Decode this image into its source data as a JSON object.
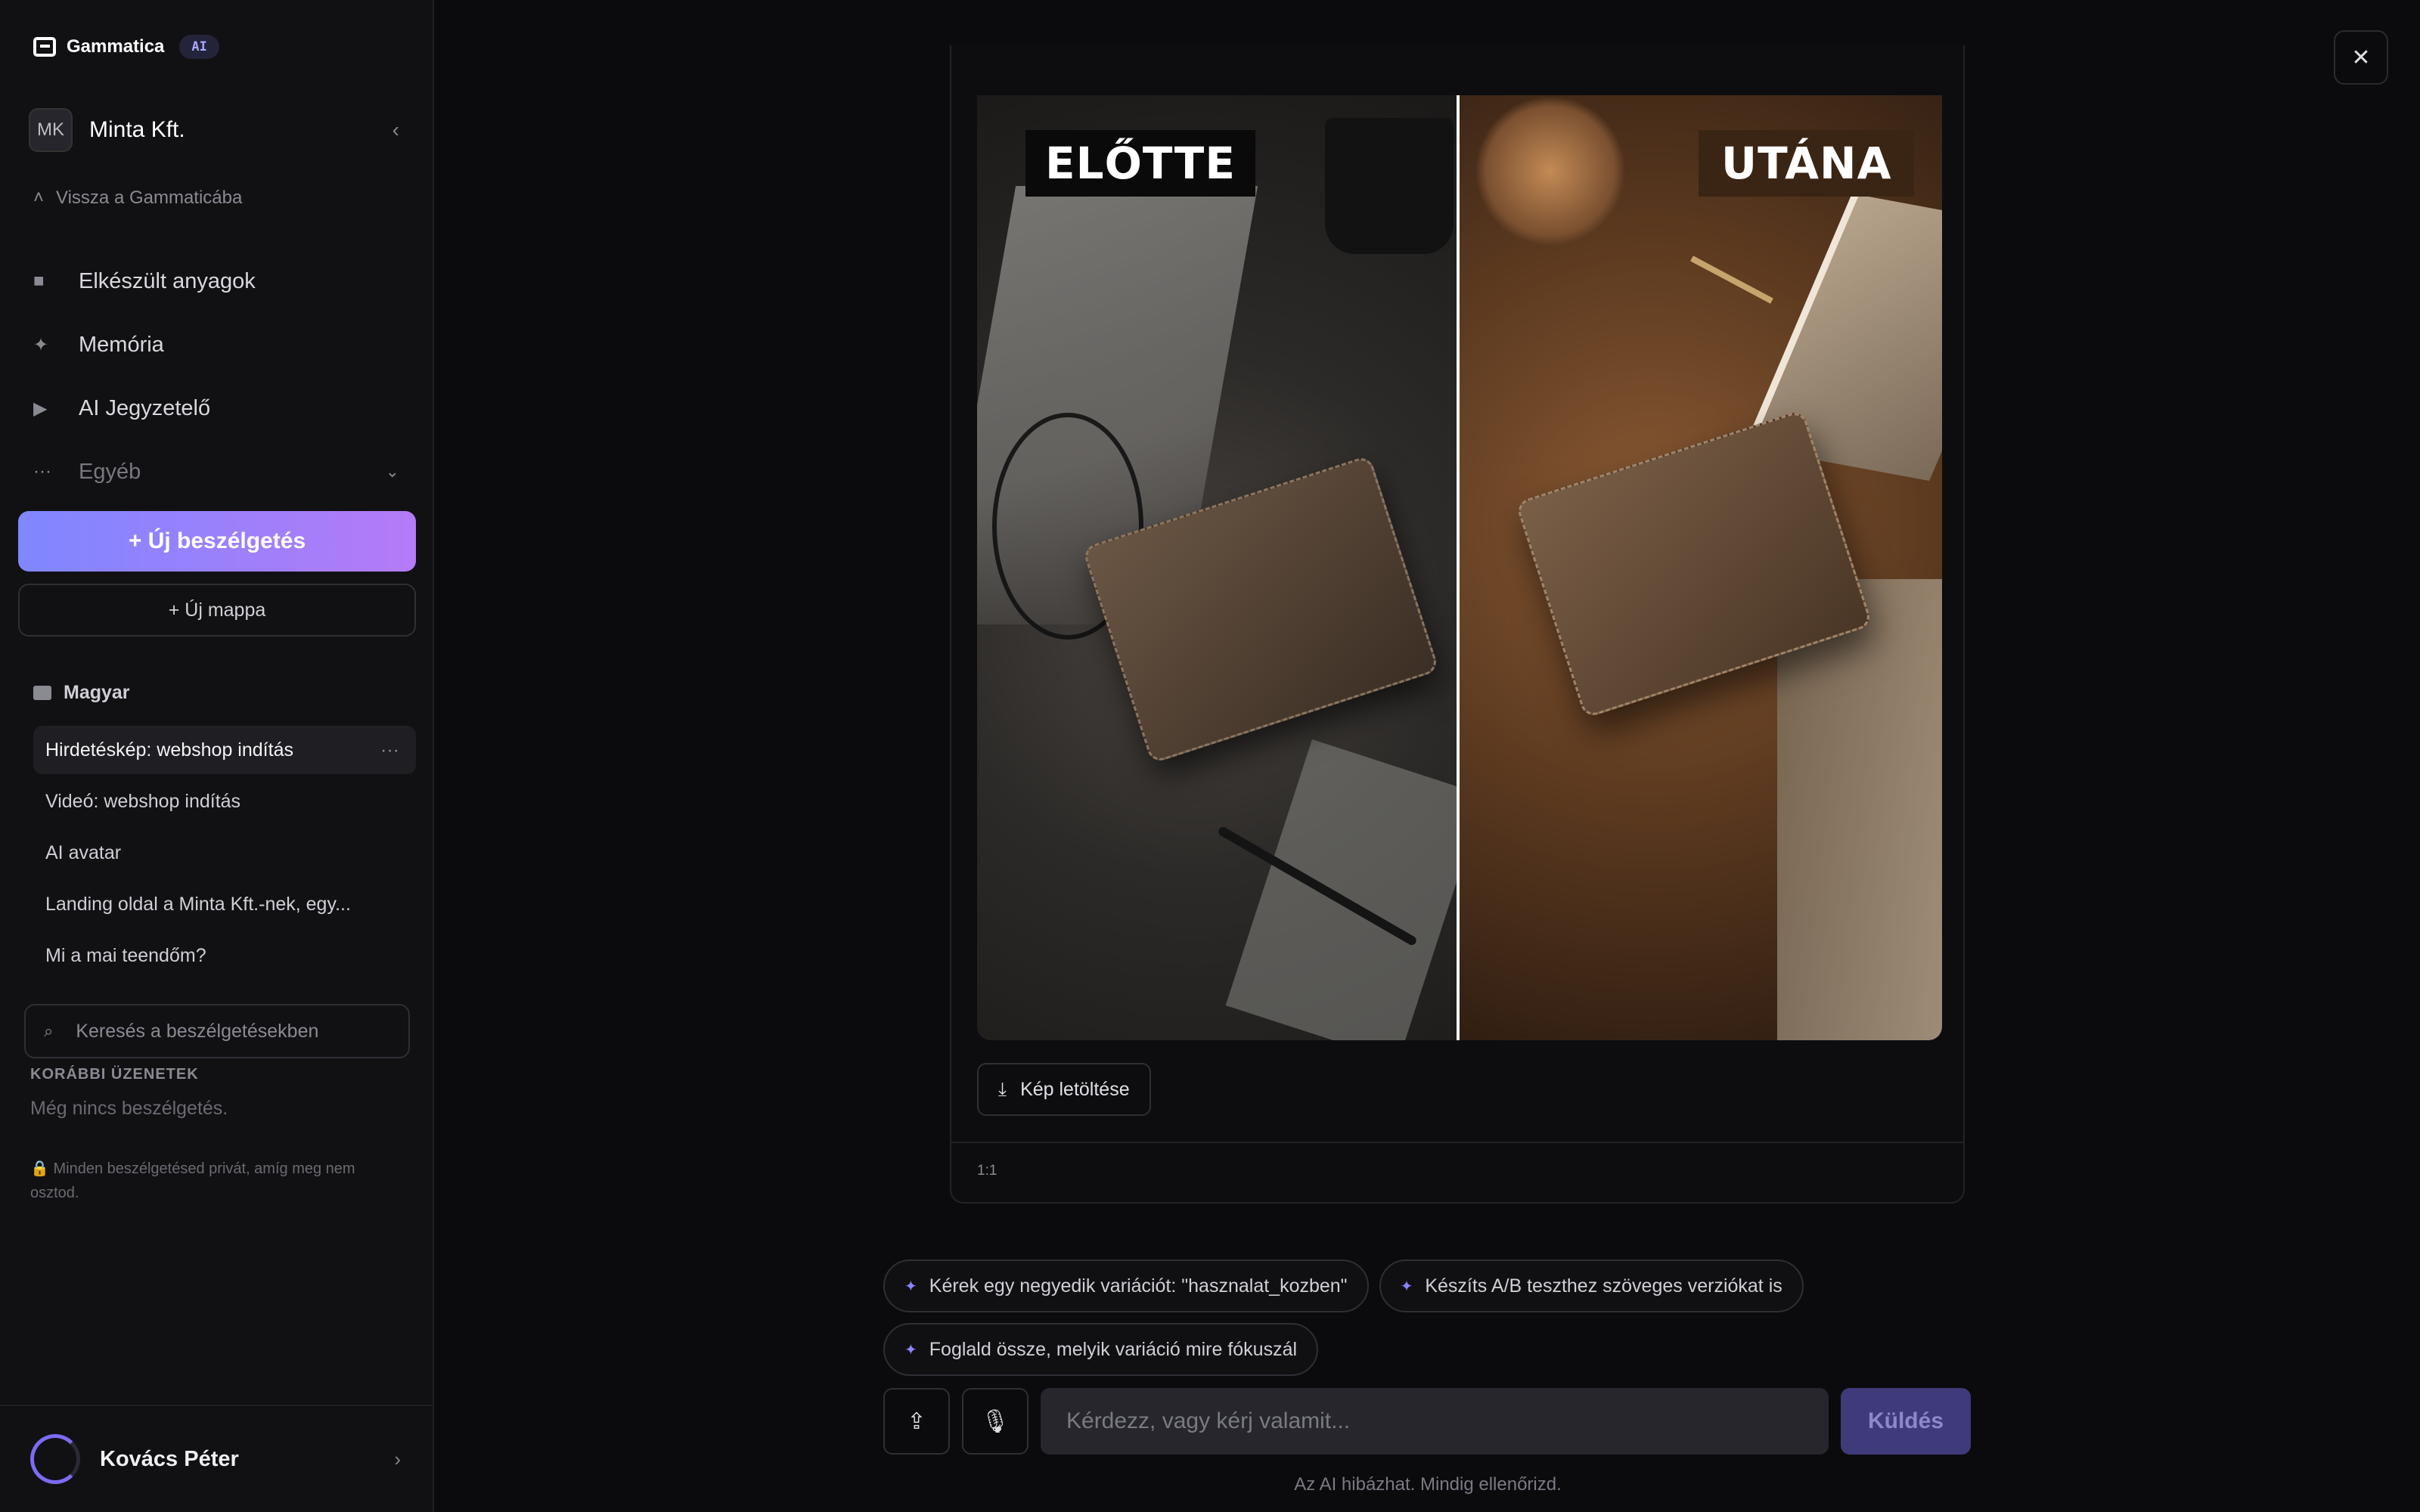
{
  "brand": {
    "name": "Gammatica",
    "badge": "AI"
  },
  "org": {
    "initials": "MK",
    "name": "Minta Kft."
  },
  "back_link": "Vissza a Gammaticába",
  "nav": [
    {
      "label": "Elkészült anyagok",
      "icon": "folder-icon"
    },
    {
      "label": "Memória",
      "icon": "sparkle-icon"
    },
    {
      "label": "AI Jegyzetelő",
      "icon": "video-icon"
    },
    {
      "label": "Egyéb",
      "icon": "dots-icon"
    }
  ],
  "buttons": {
    "new_chat": "+ Új beszélgetés",
    "new_folder": "+ Új mappa",
    "download": "Kép letöltése",
    "send": "Küldés"
  },
  "folder": {
    "name": "Magyar"
  },
  "conversations": [
    "Hirdetéskép: webshop indítás",
    "Videó: webshop indítás",
    "AI avatar",
    "Landing oldal a Minta Kft.-nek, egy...",
    "Mi a mai teendőm?"
  ],
  "search": {
    "placeholder": "Keresés a beszélgetésekben"
  },
  "history": {
    "label": "KORÁBBI ÜZENETEK",
    "empty": "Még nincs beszélgetés."
  },
  "privacy_note": "Minden beszélgetésed privát, amíg meg nem osztod.",
  "user": {
    "name": "Kovács Péter"
  },
  "image": {
    "label_before": "ELŐTTE",
    "label_after": "UTÁNA",
    "ratio": "1:1"
  },
  "suggestions": [
    "Kérek egy negyedik variációt: \"hasznalat_kozben\"",
    "Készíts A/B teszthez szöveges verziókat is",
    "Foglald össze, melyik variáció mire fókuszál"
  ],
  "composer": {
    "placeholder": "Kérdezz, vagy kérj valamit..."
  },
  "disclaimer": "Az AI hibázhat. Mindig ellenőrizd.",
  "colors": {
    "accent_start": "#7f87ff",
    "accent_end": "#b57af7",
    "send_bg": "#3f3a7a"
  }
}
